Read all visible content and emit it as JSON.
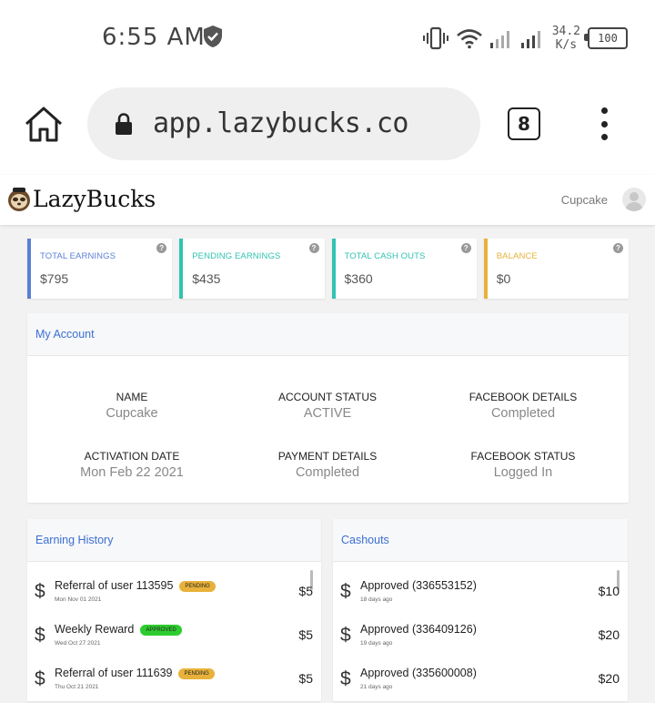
{
  "status_bar": {
    "time": "6:55 AM",
    "speed": "34.2",
    "speed_unit": "K/s",
    "battery": "100"
  },
  "browser": {
    "url": "app.lazybucks.co",
    "tab_count": "8"
  },
  "app": {
    "brand": "LazyBucks",
    "username": "Cupcake"
  },
  "stats": [
    {
      "label": "TOTAL EARNINGS",
      "value": "$795",
      "color": "#5b7fd6"
    },
    {
      "label": "PENDING EARNINGS",
      "value": "$435",
      "color": "#32c3b1"
    },
    {
      "label": "TOTAL CASH OUTS",
      "value": "$360",
      "color": "#32c3b1"
    },
    {
      "label": "BALANCE",
      "value": "$0",
      "color": "#e8b23a"
    }
  ],
  "account": {
    "title": "My Account",
    "fields": [
      {
        "label": "NAME",
        "value": "Cupcake"
      },
      {
        "label": "ACCOUNT STATUS",
        "value": "ACTIVE"
      },
      {
        "label": "FACEBOOK DETAILS",
        "value": "Completed"
      },
      {
        "label": "ACTIVATION DATE",
        "value": "Mon Feb 22 2021"
      },
      {
        "label": "PAYMENT DETAILS",
        "value": "Completed"
      },
      {
        "label": "FACEBOOK STATUS",
        "value": "Logged In"
      }
    ]
  },
  "earning_history": {
    "title": "Earning History",
    "currency_symbol": "$",
    "items": [
      {
        "title": "Referral of user 113595",
        "date": "Mon Nov 01 2021",
        "badge": "PENDING",
        "badge_color": "#e8b23a",
        "amount": "$5"
      },
      {
        "title": "Weekly Reward",
        "date": "Wed Oct 27 2021",
        "badge": "APPROVED",
        "badge_color": "#2ecc2e",
        "amount": "$5"
      },
      {
        "title": "Referral of user 111639",
        "date": "Thu Oct 21 2021",
        "badge": "PENDING",
        "badge_color": "#e8b23a",
        "amount": "$5"
      }
    ]
  },
  "cashouts": {
    "title": "Cashouts",
    "currency_symbol": "$",
    "items": [
      {
        "title": "Approved (336553152)",
        "date": "18 days ago",
        "amount": "$10"
      },
      {
        "title": "Approved (336409126)",
        "date": "19 days ago",
        "amount": "$20"
      },
      {
        "title": "Approved (335600008)",
        "date": "21 days ago",
        "amount": "$20"
      }
    ]
  },
  "colors": {
    "accent_blue": "#3b6fd1",
    "pending": "#e8b23a",
    "approved": "#2ecc2e"
  }
}
